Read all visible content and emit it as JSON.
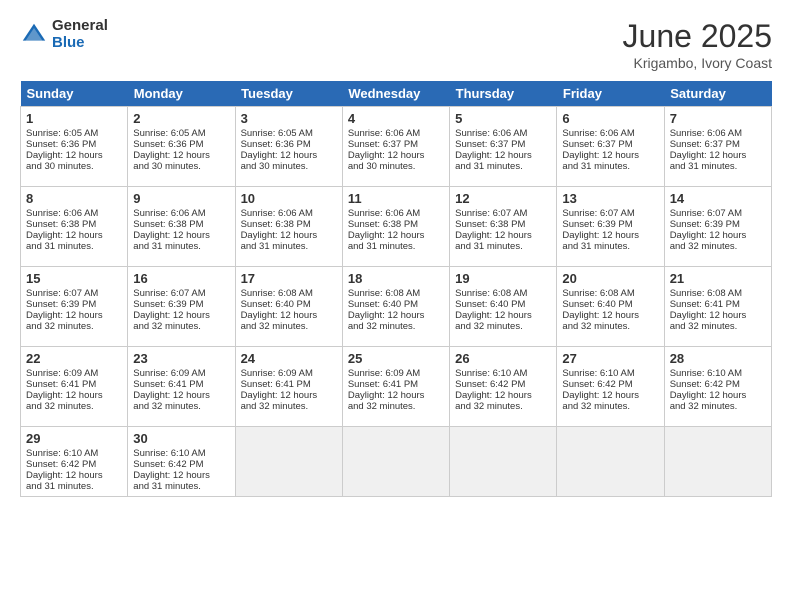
{
  "logo": {
    "general": "General",
    "blue": "Blue"
  },
  "title": "June 2025",
  "subtitle": "Krigambo, Ivory Coast",
  "headers": [
    "Sunday",
    "Monday",
    "Tuesday",
    "Wednesday",
    "Thursday",
    "Friday",
    "Saturday"
  ],
  "weeks": [
    [
      {
        "day": 1,
        "lines": [
          "Sunrise: 6:05 AM",
          "Sunset: 6:36 PM",
          "Daylight: 12 hours",
          "and 30 minutes."
        ]
      },
      {
        "day": 2,
        "lines": [
          "Sunrise: 6:05 AM",
          "Sunset: 6:36 PM",
          "Daylight: 12 hours",
          "and 30 minutes."
        ]
      },
      {
        "day": 3,
        "lines": [
          "Sunrise: 6:05 AM",
          "Sunset: 6:36 PM",
          "Daylight: 12 hours",
          "and 30 minutes."
        ]
      },
      {
        "day": 4,
        "lines": [
          "Sunrise: 6:06 AM",
          "Sunset: 6:37 PM",
          "Daylight: 12 hours",
          "and 30 minutes."
        ]
      },
      {
        "day": 5,
        "lines": [
          "Sunrise: 6:06 AM",
          "Sunset: 6:37 PM",
          "Daylight: 12 hours",
          "and 31 minutes."
        ]
      },
      {
        "day": 6,
        "lines": [
          "Sunrise: 6:06 AM",
          "Sunset: 6:37 PM",
          "Daylight: 12 hours",
          "and 31 minutes."
        ]
      },
      {
        "day": 7,
        "lines": [
          "Sunrise: 6:06 AM",
          "Sunset: 6:37 PM",
          "Daylight: 12 hours",
          "and 31 minutes."
        ]
      }
    ],
    [
      {
        "day": 8,
        "lines": [
          "Sunrise: 6:06 AM",
          "Sunset: 6:38 PM",
          "Daylight: 12 hours",
          "and 31 minutes."
        ]
      },
      {
        "day": 9,
        "lines": [
          "Sunrise: 6:06 AM",
          "Sunset: 6:38 PM",
          "Daylight: 12 hours",
          "and 31 minutes."
        ]
      },
      {
        "day": 10,
        "lines": [
          "Sunrise: 6:06 AM",
          "Sunset: 6:38 PM",
          "Daylight: 12 hours",
          "and 31 minutes."
        ]
      },
      {
        "day": 11,
        "lines": [
          "Sunrise: 6:06 AM",
          "Sunset: 6:38 PM",
          "Daylight: 12 hours",
          "and 31 minutes."
        ]
      },
      {
        "day": 12,
        "lines": [
          "Sunrise: 6:07 AM",
          "Sunset: 6:38 PM",
          "Daylight: 12 hours",
          "and 31 minutes."
        ]
      },
      {
        "day": 13,
        "lines": [
          "Sunrise: 6:07 AM",
          "Sunset: 6:39 PM",
          "Daylight: 12 hours",
          "and 31 minutes."
        ]
      },
      {
        "day": 14,
        "lines": [
          "Sunrise: 6:07 AM",
          "Sunset: 6:39 PM",
          "Daylight: 12 hours",
          "and 32 minutes."
        ]
      }
    ],
    [
      {
        "day": 15,
        "lines": [
          "Sunrise: 6:07 AM",
          "Sunset: 6:39 PM",
          "Daylight: 12 hours",
          "and 32 minutes."
        ]
      },
      {
        "day": 16,
        "lines": [
          "Sunrise: 6:07 AM",
          "Sunset: 6:39 PM",
          "Daylight: 12 hours",
          "and 32 minutes."
        ]
      },
      {
        "day": 17,
        "lines": [
          "Sunrise: 6:08 AM",
          "Sunset: 6:40 PM",
          "Daylight: 12 hours",
          "and 32 minutes."
        ]
      },
      {
        "day": 18,
        "lines": [
          "Sunrise: 6:08 AM",
          "Sunset: 6:40 PM",
          "Daylight: 12 hours",
          "and 32 minutes."
        ]
      },
      {
        "day": 19,
        "lines": [
          "Sunrise: 6:08 AM",
          "Sunset: 6:40 PM",
          "Daylight: 12 hours",
          "and 32 minutes."
        ]
      },
      {
        "day": 20,
        "lines": [
          "Sunrise: 6:08 AM",
          "Sunset: 6:40 PM",
          "Daylight: 12 hours",
          "and 32 minutes."
        ]
      },
      {
        "day": 21,
        "lines": [
          "Sunrise: 6:08 AM",
          "Sunset: 6:41 PM",
          "Daylight: 12 hours",
          "and 32 minutes."
        ]
      }
    ],
    [
      {
        "day": 22,
        "lines": [
          "Sunrise: 6:09 AM",
          "Sunset: 6:41 PM",
          "Daylight: 12 hours",
          "and 32 minutes."
        ]
      },
      {
        "day": 23,
        "lines": [
          "Sunrise: 6:09 AM",
          "Sunset: 6:41 PM",
          "Daylight: 12 hours",
          "and 32 minutes."
        ]
      },
      {
        "day": 24,
        "lines": [
          "Sunrise: 6:09 AM",
          "Sunset: 6:41 PM",
          "Daylight: 12 hours",
          "and 32 minutes."
        ]
      },
      {
        "day": 25,
        "lines": [
          "Sunrise: 6:09 AM",
          "Sunset: 6:41 PM",
          "Daylight: 12 hours",
          "and 32 minutes."
        ]
      },
      {
        "day": 26,
        "lines": [
          "Sunrise: 6:10 AM",
          "Sunset: 6:42 PM",
          "Daylight: 12 hours",
          "and 32 minutes."
        ]
      },
      {
        "day": 27,
        "lines": [
          "Sunrise: 6:10 AM",
          "Sunset: 6:42 PM",
          "Daylight: 12 hours",
          "and 32 minutes."
        ]
      },
      {
        "day": 28,
        "lines": [
          "Sunrise: 6:10 AM",
          "Sunset: 6:42 PM",
          "Daylight: 12 hours",
          "and 32 minutes."
        ]
      }
    ],
    [
      {
        "day": 29,
        "lines": [
          "Sunrise: 6:10 AM",
          "Sunset: 6:42 PM",
          "Daylight: 12 hours",
          "and 31 minutes."
        ]
      },
      {
        "day": 30,
        "lines": [
          "Sunrise: 6:10 AM",
          "Sunset: 6:42 PM",
          "Daylight: 12 hours",
          "and 31 minutes."
        ]
      },
      null,
      null,
      null,
      null,
      null
    ]
  ]
}
